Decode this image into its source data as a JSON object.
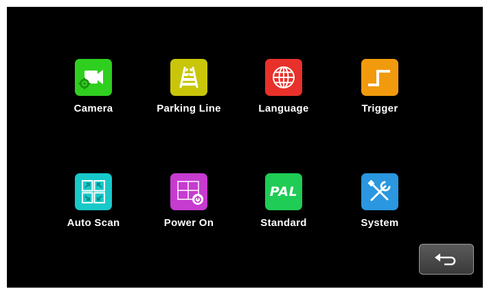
{
  "menu": {
    "items": [
      {
        "label": "Camera",
        "icon": "camera-icon",
        "color": "#2fcf1f"
      },
      {
        "label": "Parking Line",
        "icon": "parking-line-icon",
        "color": "#c9c60a"
      },
      {
        "label": "Language",
        "icon": "globe-icon",
        "color": "#e8312a"
      },
      {
        "label": "Trigger",
        "icon": "trigger-icon",
        "color": "#f29a0e"
      },
      {
        "label": "Auto Scan",
        "icon": "auto-scan-icon",
        "color": "#18c9c9"
      },
      {
        "label": "Power On",
        "icon": "power-on-icon",
        "color": "#c63bd0"
      },
      {
        "label": "Standard",
        "icon": "pal-icon",
        "color": "#1fcc55",
        "icon_text": "PAL"
      },
      {
        "label": "System",
        "icon": "tools-icon",
        "color": "#2a97e0"
      }
    ]
  },
  "back_button": {
    "icon": "back-arrow-icon"
  }
}
